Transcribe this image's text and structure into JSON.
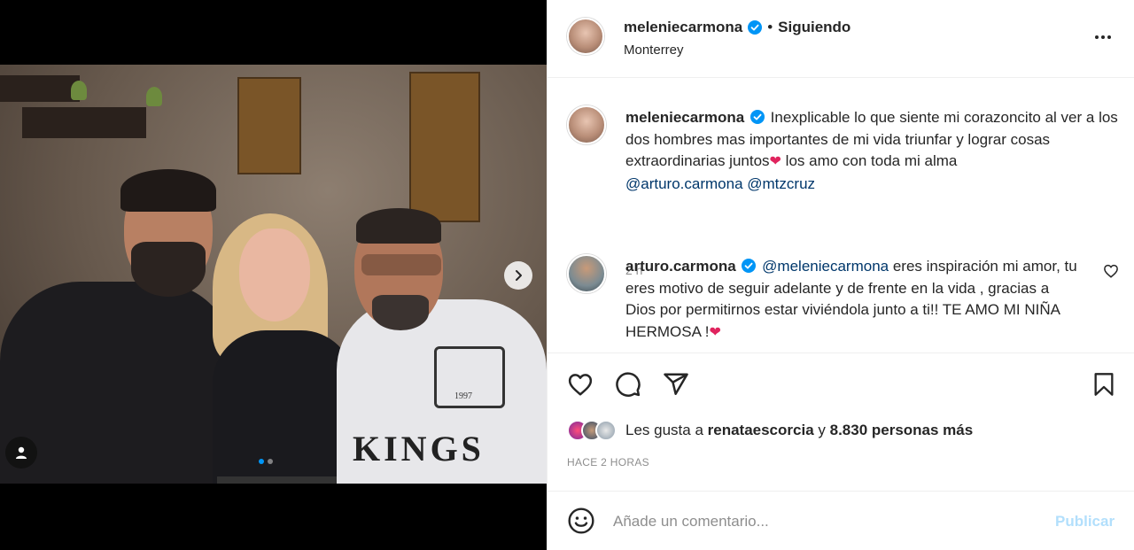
{
  "post": {
    "username": "meleniecarmona",
    "separator": "•",
    "follow_status": "Siguiendo",
    "location": "Monterrey",
    "verified_icon": "verified-badge-icon",
    "more_icon": "more-options-icon"
  },
  "caption": {
    "username": "meleniecarmona",
    "text": "Inexplicable lo que siente mi corazoncito al ver a los dos hombres mas importantes de mi vida triunfar y lograr cosas extraordinarias juntos",
    "emoji": "❤",
    "text2": " los amo con toda mi alma",
    "mention1": "@arturo.carmona",
    "mention2": "@mtzcruz",
    "time": "2 h"
  },
  "comment": {
    "username": "arturo.carmona",
    "mention": "@meleniecarmona",
    "text": " eres inspiración mi amor, tu eres motivo de seguir adelante y de frente en la vida , gracias a Dios por permitirnos estar viviéndola junto a ti!! TE AMO MI NIÑA HERMOSA !",
    "emoji": "❤"
  },
  "likes": {
    "prefix": "Les gusta a ",
    "user": "renataescorcia",
    "middle": " y ",
    "count": "8.830 personas más"
  },
  "posted": "HACE 2 HORAS",
  "add_comment": {
    "placeholder": "Añade un comentario...",
    "publish": "Publicar"
  },
  "carousel": {
    "total_slides": 2,
    "current_slide": 1
  },
  "photo_print": {
    "shirt_text": "KINGS",
    "badge_text": "1997"
  },
  "colors": {
    "link": "#00376b",
    "verified": "#0095f6",
    "publish_disabled": "#b2dffc",
    "secondary": "#8e8e8e"
  }
}
